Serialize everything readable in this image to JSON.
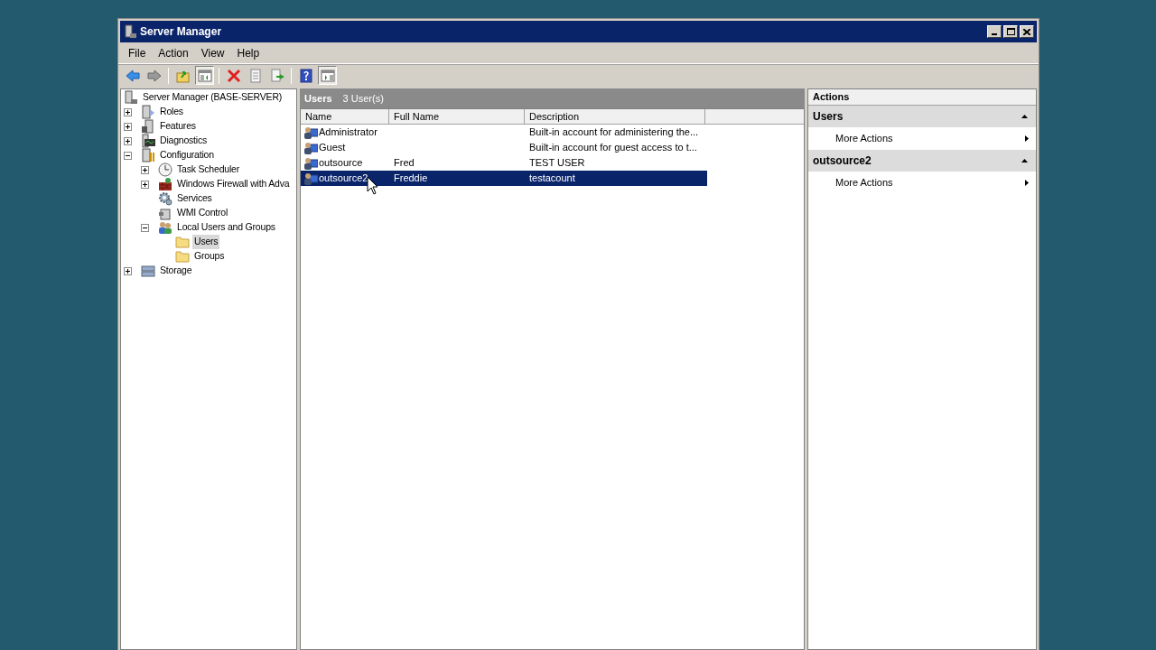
{
  "window": {
    "title": "Server Manager"
  },
  "menu": [
    "File",
    "Action",
    "View",
    "Help"
  ],
  "toolbar": [
    {
      "kind": "back",
      "pressed": false
    },
    {
      "kind": "forward",
      "pressed": false
    },
    {
      "kind": "separator"
    },
    {
      "kind": "up",
      "pressed": false
    },
    {
      "kind": "tree",
      "pressed": true
    },
    {
      "kind": "separator"
    },
    {
      "kind": "delete",
      "pressed": false
    },
    {
      "kind": "properties",
      "pressed": false
    },
    {
      "kind": "export",
      "pressed": false
    },
    {
      "kind": "separator"
    },
    {
      "kind": "help",
      "pressed": false
    },
    {
      "kind": "actionpane",
      "pressed": true
    }
  ],
  "tree": [
    {
      "label": "Server Manager (BASE-SERVER)",
      "kind": "server",
      "selected": false,
      "children": [
        {
          "label": "Roles",
          "kind": "roles",
          "expanded": false,
          "selected": false
        },
        {
          "label": "Features",
          "kind": "features",
          "expanded": false,
          "selected": false
        },
        {
          "label": "Diagnostics",
          "kind": "diagnostics",
          "expanded": false,
          "selected": false
        },
        {
          "label": "Configuration",
          "kind": "config",
          "expanded": true,
          "selected": false,
          "children": [
            {
              "label": "Task Scheduler",
              "kind": "clock",
              "expanded": false,
              "selected": false
            },
            {
              "label": "Windows Firewall with Adva",
              "kind": "firewall",
              "expanded": false,
              "selected": false
            },
            {
              "label": "Services",
              "kind": "gear",
              "selected": false
            },
            {
              "label": "WMI Control",
              "kind": "wmi",
              "selected": false
            },
            {
              "label": "Local Users and Groups",
              "kind": "users",
              "expanded": true,
              "selected": false,
              "children": [
                {
                  "label": "Users",
                  "kind": "folder",
                  "selected": true
                },
                {
                  "label": "Groups",
                  "kind": "folder",
                  "selected": false
                }
              ]
            }
          ]
        },
        {
          "label": "Storage",
          "kind": "storage",
          "expanded": false,
          "selected": false
        }
      ]
    }
  ],
  "list": {
    "title": "Users",
    "count": "3 User(s)",
    "columns": [
      "Name",
      "Full Name",
      "Description"
    ],
    "rows": [
      {
        "name": "Administrator",
        "full_name": "",
        "description": "Built-in account for administering the...",
        "selected": false
      },
      {
        "name": "Guest",
        "full_name": "",
        "description": "Built-in account for guest access to t...",
        "selected": false
      },
      {
        "name": "outsource",
        "full_name": "Fred",
        "description": "TEST USER",
        "selected": false
      },
      {
        "name": "outsource2",
        "full_name": "Freddie",
        "description": "testacount",
        "selected": true
      }
    ]
  },
  "actions": {
    "title": "Actions",
    "sections": [
      {
        "title": "Users",
        "expanded": true,
        "items": [
          "More Actions"
        ]
      },
      {
        "title": "outsource2",
        "expanded": true,
        "items": [
          "More Actions"
        ]
      }
    ]
  }
}
